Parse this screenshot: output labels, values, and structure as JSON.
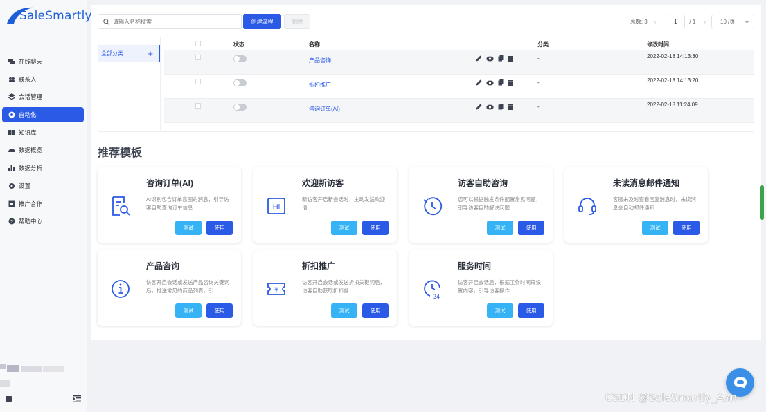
{
  "brand": {
    "name": "SaleSmartly",
    "color": "#1f5fd6"
  },
  "sidebar": {
    "items": [
      {
        "label": "在线聊天",
        "icon": "chat-icon"
      },
      {
        "label": "联系人",
        "icon": "contacts-icon"
      },
      {
        "label": "会话管理",
        "icon": "layers-icon"
      },
      {
        "label": "自动化",
        "icon": "automation-icon",
        "active": true
      },
      {
        "label": "知识库",
        "icon": "book-icon"
      },
      {
        "label": "数据概览",
        "icon": "dashboard-icon"
      },
      {
        "label": "数据分析",
        "icon": "bar-chart-icon"
      },
      {
        "label": "设置",
        "icon": "gear-icon"
      },
      {
        "label": "推广合作",
        "icon": "promo-icon"
      },
      {
        "label": "帮助中心",
        "icon": "help-icon"
      }
    ]
  },
  "toolbar": {
    "search_placeholder": "请输入名称搜索",
    "create_label": "创建流程",
    "delete_label": "删除"
  },
  "pager": {
    "total_label": "总数: 3",
    "current_page": "1",
    "page_total": "/ 1",
    "page_size": "10 /页"
  },
  "categories": [
    {
      "label": "全部分类"
    }
  ],
  "table": {
    "headers": {
      "status": "状态",
      "name": "名称",
      "category": "分类",
      "modified": "修改时间"
    },
    "rows": [
      {
        "name": "产品咨询",
        "category": "-",
        "modified": "2022-02-18 14:13:30"
      },
      {
        "name": "折扣推广",
        "category": "-",
        "modified": "2022-02-18 14:13:20"
      },
      {
        "name": "咨询订单(AI)",
        "category": "-",
        "modified": "2022-02-18 11:24:09"
      }
    ]
  },
  "templates": {
    "title": "推荐模板",
    "test_label": "测试",
    "use_label": "使用",
    "cards": [
      {
        "title": "咨询订单(AI)",
        "desc": "AI识别包含订单意图的消息，引导访客自助查询订单信息",
        "icon": "order-search-icon"
      },
      {
        "title": "欢迎新访客",
        "desc": "新访客开启新会话时，主动发送欢迎语",
        "icon": "hi-icon"
      },
      {
        "title": "访客自助咨询",
        "desc": "您可以根据触发条件配置常见问题，引导访客自助解决问题",
        "icon": "self-service-icon"
      },
      {
        "title": "未读消息邮件通知",
        "desc": "客服未及时查看回复消息时，未读消息会自动邮件通知",
        "icon": "headset-icon"
      },
      {
        "title": "产品咨询",
        "desc": "访客开启会话或发送产品咨询关键词后，推送常见的商品列表，引...",
        "icon": "info-icon"
      },
      {
        "title": "折扣推广",
        "desc": "访客开启会话或发送折扣关键词后，访客自助获取折扣券",
        "icon": "coupon-icon"
      },
      {
        "title": "服务时间",
        "desc": "访客开启会话后，根据工作时间段设置内容，引导访客操作",
        "icon": "clock-24-icon"
      }
    ]
  },
  "watermark": "CSDN @SaleSmartly_Ann"
}
